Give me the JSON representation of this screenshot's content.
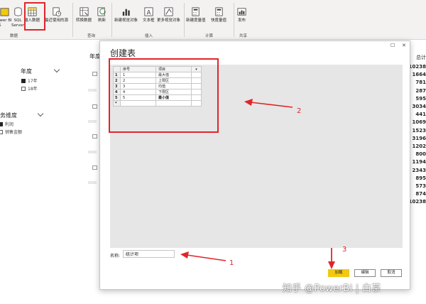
{
  "ribbon": {
    "buttons": [
      {
        "id": "powerbi",
        "label": "ower BI\n集"
      },
      {
        "id": "sql",
        "label": "SQL\nServer"
      },
      {
        "id": "enter-data",
        "label": "输入数据"
      },
      {
        "id": "recent",
        "label": "最近使用的源"
      },
      {
        "id": "transform",
        "label": "转换数据"
      },
      {
        "id": "refresh",
        "label": "刷新"
      },
      {
        "id": "new-visual",
        "label": "新建视觉对象"
      },
      {
        "id": "textbox",
        "label": "文本框"
      },
      {
        "id": "more-visuals",
        "label": "更多视觉对象"
      },
      {
        "id": "new-measure",
        "label": "新建度量值"
      },
      {
        "id": "quick-measure",
        "label": "快度量值"
      },
      {
        "id": "publish",
        "label": "发布"
      }
    ],
    "groups": {
      "data": "数据",
      "query": "查询",
      "insert": "插入",
      "calc": "计算",
      "share": "共享"
    }
  },
  "canvas": {
    "partial_header": "年度",
    "year_slicer": {
      "title": "年度",
      "items": [
        {
          "label": "17年",
          "checked": true
        },
        {
          "label": "18年",
          "checked": false
        }
      ]
    },
    "finance_slicer": {
      "title": "财务维度",
      "items": [
        {
          "label": "利润",
          "checked": true
        },
        {
          "label": "销售金额",
          "checked": false
        }
      ]
    },
    "total_header": "总计",
    "totals": [
      "10238",
      "1664",
      "781",
      "287",
      "595",
      "3034",
      "441",
      "1069",
      "1523",
      "3196",
      "1202",
      "800",
      "1194",
      "2343",
      "895",
      "573",
      "874",
      "10238"
    ]
  },
  "dialog": {
    "title": "创建表",
    "table": {
      "headers": [
        "序号",
        "项目"
      ],
      "rows": [
        [
          "1",
          "1",
          "最大值"
        ],
        [
          "2",
          "2",
          "上限区"
        ],
        [
          "3",
          "3",
          "均值"
        ],
        [
          "4",
          "4",
          "下限区"
        ],
        [
          "5",
          "5",
          "最小值"
        ]
      ],
      "new_row_marker": "*"
    },
    "name_label": "名称:",
    "name_value": "统计项",
    "buttons": {
      "load": "加载",
      "edit": "编辑",
      "cancel": "取消"
    }
  },
  "annotations": {
    "n1": "1",
    "n2": "2",
    "n3": "3",
    "color": "#e0252a"
  },
  "watermark": "知乎 @PowerBI | 白茶",
  "colors": {
    "accent_yellow": "#f2c811",
    "annotation_red": "#e0252a",
    "ribbon_bg": "#f3f2f1"
  }
}
